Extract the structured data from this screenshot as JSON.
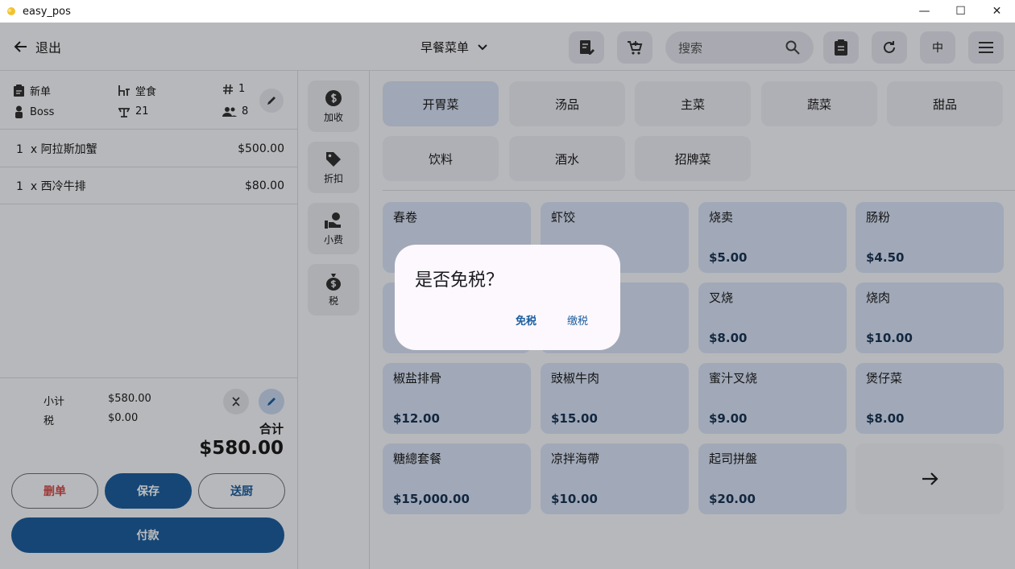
{
  "window": {
    "title": "easy_pos",
    "minimize": "—",
    "maximize": "☐",
    "close": "✕"
  },
  "topbar": {
    "back_label": "退出",
    "menu_select": "早餐菜单",
    "search_placeholder": "搜索",
    "lang_label": "中"
  },
  "order": {
    "status": "新单",
    "dine_type": "堂食",
    "order_number": "1",
    "staff": "Boss",
    "table": "21",
    "guests": "8"
  },
  "items": [
    {
      "qty": "1",
      "x": "x",
      "name": "阿拉斯加蟹",
      "price": "$500.00"
    },
    {
      "qty": "1",
      "x": "x",
      "name": "西冷牛排",
      "price": "$80.00"
    }
  ],
  "totals": {
    "subtotal_label": "小计",
    "subtotal": "$580.00",
    "tax_label": "税",
    "tax": "$0.00",
    "total_label": "合计",
    "total": "$580.00"
  },
  "actions": {
    "delete": "删单",
    "save": "保存",
    "kitchen": "送厨",
    "pay": "付款"
  },
  "side_actions": [
    "加收",
    "折扣",
    "小费",
    "税"
  ],
  "categories": [
    "开胃菜",
    "汤品",
    "主菜",
    "蔬菜",
    "甜品",
    "饮料",
    "酒水",
    "招牌菜"
  ],
  "dishes": [
    {
      "name": "春卷",
      "price": ""
    },
    {
      "name": "虾饺",
      "price": ""
    },
    {
      "name": "烧卖",
      "price": "$5.00"
    },
    {
      "name": "肠粉",
      "price": "$4.50"
    },
    {
      "name": "",
      "price": ""
    },
    {
      "name": "",
      "price": ""
    },
    {
      "name": "叉烧",
      "price": "$8.00"
    },
    {
      "name": "烧肉",
      "price": "$10.00"
    },
    {
      "name": "椒盐排骨",
      "price": "$12.00"
    },
    {
      "name": "豉椒牛肉",
      "price": "$15.00"
    },
    {
      "name": "蜜汁叉烧",
      "price": "$9.00"
    },
    {
      "name": "煲仔菜",
      "price": "$8.00"
    },
    {
      "name": "糖總套餐",
      "price": "$15,000.00"
    },
    {
      "name": "凉拌海帶",
      "price": "$10.00"
    },
    {
      "name": "起司拼盤",
      "price": "$20.00"
    }
  ],
  "dialog": {
    "question": "是否免税？",
    "exempt": "免税",
    "pay_tax": "缴税"
  },
  "colors": {
    "primary": "#1d5fa0",
    "dish_bg": "#d9e4f8",
    "danger": "#d24b4b"
  }
}
